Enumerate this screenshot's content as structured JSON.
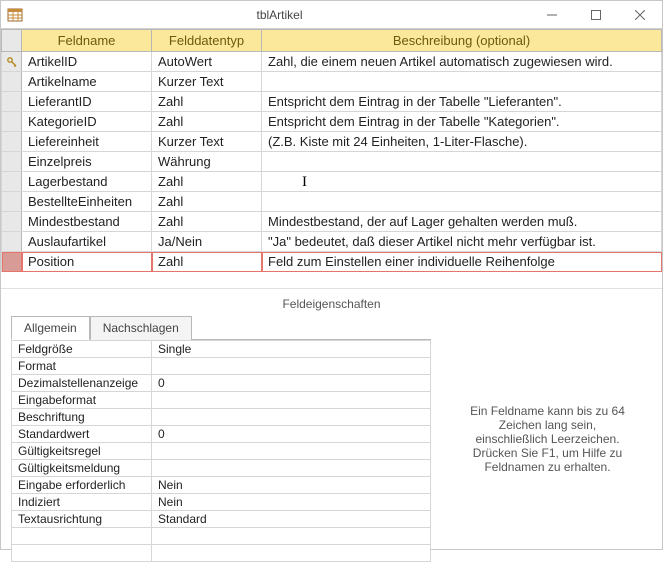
{
  "window": {
    "title": "tblArtikel"
  },
  "columns": {
    "field": "Feldname",
    "type": "Felddatentyp",
    "desc": "Beschreibung (optional)"
  },
  "rows": [
    {
      "key": true,
      "name": "ArtikelID",
      "type": "AutoWert",
      "desc": "Zahl, die einem neuen Artikel automatisch zugewiesen wird."
    },
    {
      "key": false,
      "name": "Artikelname",
      "type": "Kurzer Text",
      "desc": ""
    },
    {
      "key": false,
      "name": "LieferantID",
      "type": "Zahl",
      "desc": "Entspricht dem Eintrag in der Tabelle \"Lieferanten\"."
    },
    {
      "key": false,
      "name": "KategorieID",
      "type": "Zahl",
      "desc": "Entspricht dem Eintrag in der Tabelle \"Kategorien\"."
    },
    {
      "key": false,
      "name": "Liefereinheit",
      "type": "Kurzer Text",
      "desc": "(Z.B. Kiste mit 24 Einheiten, 1-Liter-Flasche)."
    },
    {
      "key": false,
      "name": "Einzelpreis",
      "type": "Währung",
      "desc": ""
    },
    {
      "key": false,
      "name": "Lagerbestand",
      "type": "Zahl",
      "desc": "",
      "caret": true
    },
    {
      "key": false,
      "name": "BestellteEinheiten",
      "type": "Zahl",
      "desc": ""
    },
    {
      "key": false,
      "name": "Mindestbestand",
      "type": "Zahl",
      "desc": "Mindestbestand, der auf Lager gehalten werden muß."
    },
    {
      "key": false,
      "name": "Auslaufartikel",
      "type": "Ja/Nein",
      "desc": "\"Ja\" bedeutet, daß dieser Artikel nicht mehr verfügbar ist."
    },
    {
      "key": false,
      "name": "Position",
      "type": "Zahl",
      "desc": "Feld zum Einstellen einer individuelle Reihenfolge",
      "highlight": true
    }
  ],
  "propsHeader": "Feldeigenschaften",
  "tabs": {
    "general": "Allgemein",
    "lookup": "Nachschlagen"
  },
  "props": [
    {
      "name": "Feldgröße",
      "value": "Single"
    },
    {
      "name": "Format",
      "value": ""
    },
    {
      "name": "Dezimalstellenanzeige",
      "value": "0"
    },
    {
      "name": "Eingabeformat",
      "value": ""
    },
    {
      "name": "Beschriftung",
      "value": ""
    },
    {
      "name": "Standardwert",
      "value": "0"
    },
    {
      "name": "Gültigkeitsregel",
      "value": ""
    },
    {
      "name": "Gültigkeitsmeldung",
      "value": ""
    },
    {
      "name": "Eingabe erforderlich",
      "value": "Nein"
    },
    {
      "name": "Indiziert",
      "value": "Nein"
    },
    {
      "name": "Textausrichtung",
      "value": "Standard"
    }
  ],
  "hint": "Ein Feldname kann bis zu 64 Zeichen lang sein, einschließlich Leerzeichen. Drücken Sie F1, um Hilfe zu Feldnamen zu erhalten."
}
